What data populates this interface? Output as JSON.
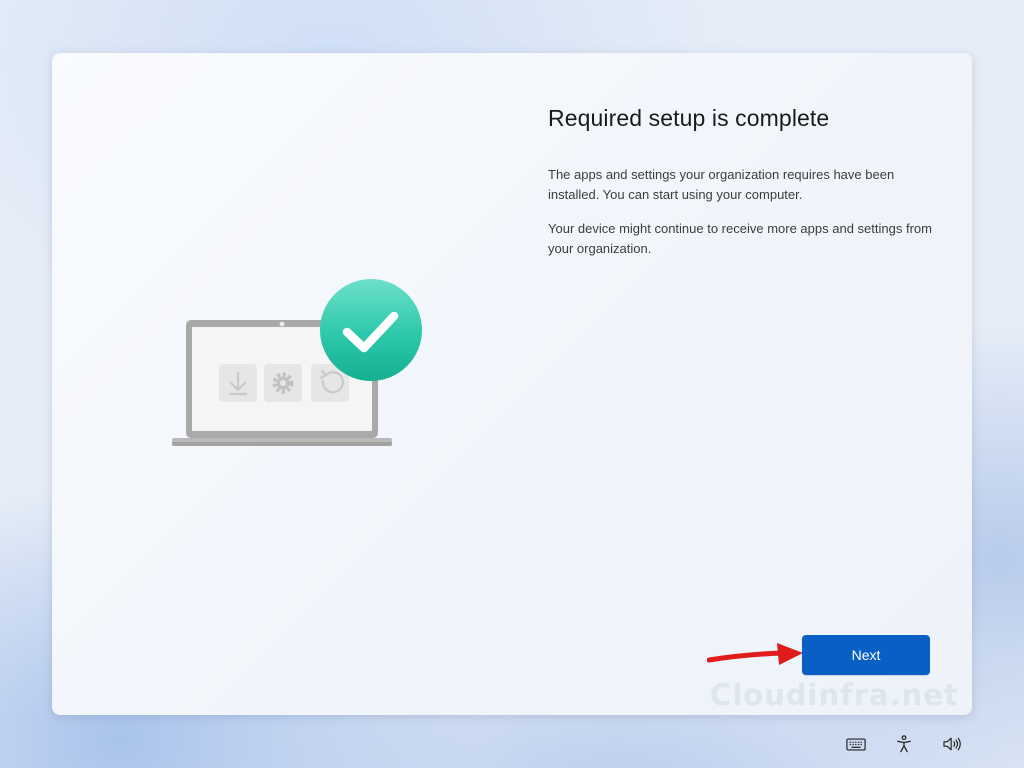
{
  "setup": {
    "title": "Required setup is complete",
    "paragraph_1": "The apps and settings your organization requires have been installed. You can start using your computer.",
    "paragraph_2": "Your device might continue to receive more apps and settings from your organization.",
    "next_label": "Next"
  },
  "illustration": {
    "laptop_icons": [
      "download-icon",
      "gear-icon",
      "refresh-icon"
    ],
    "badge_icon": "checkmark-icon",
    "badge_color": "#24c3a6"
  },
  "watermark": "Cloudinfra.net",
  "annotation": {
    "arrow_color": "#e01b1b"
  },
  "tray": {
    "icons": [
      "keyboard-icon",
      "accessibility-icon",
      "volume-icon"
    ]
  },
  "colors": {
    "accent": "#0a5fc4",
    "card_background": "#f6f8fc"
  }
}
